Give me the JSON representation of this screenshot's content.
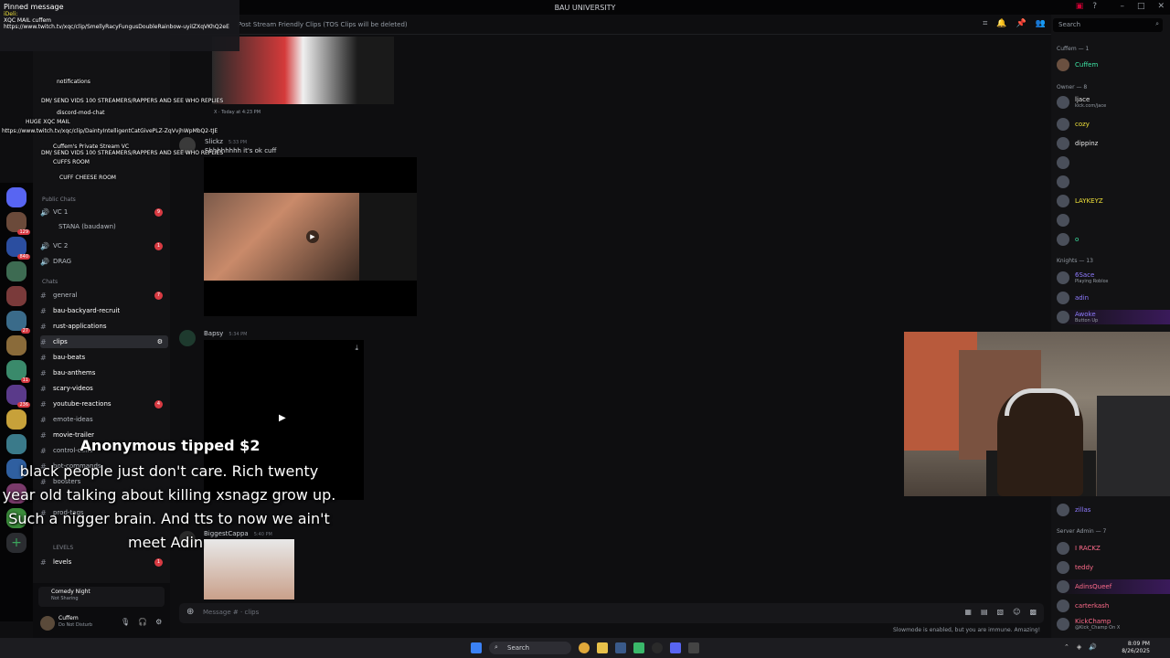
{
  "window": {
    "title": "BAU UNIVERSITY",
    "search_placeholder": "Search"
  },
  "pinned": {
    "header": "Pinned message",
    "author": "iDeli:",
    "lines": [
      "XQC MAIL cuffem",
      "https://www.twitch.tv/xqc/clip/SmellyRacyFungusDoubleRainbow-uyiIZXqVKhQ2eE"
    ]
  },
  "chat_overlay": [
    "notifications",
    "discord-mod-chat",
    "HUGE XQC MAIL",
    "https://www.twitch.tv/xqc/clip/DaintyIntelligentCatGivePLZ-ZqVvjhWpMbQ2-tJE",
    "DM/ SEND VIDS 100 STREAMERS/RAPPERS AND SEE WHO REPLIES",
    "Cuffem's Private Stream VC",
    "CUFFS ROOM",
    "CUFF CHEESE ROOM"
  ],
  "sidebar": {
    "categories": [
      "Public Chats",
      "Chats"
    ],
    "voice": [
      "VC 1",
      "VC 2",
      "DRAG"
    ],
    "voice_user": "STANA (baudawn)",
    "channels": [
      {
        "name": "general",
        "count": "7"
      },
      {
        "name": "bau-backyard-recruit",
        "count": ""
      },
      {
        "name": "rust-applications",
        "count": ""
      },
      {
        "name": "clips",
        "count": ""
      },
      {
        "name": "bau-beats",
        "count": ""
      },
      {
        "name": "bau-anthems",
        "count": ""
      },
      {
        "name": "scary-videos",
        "count": ""
      },
      {
        "name": "youtube-reactions",
        "count": "4"
      },
      {
        "name": "emote-ideas",
        "count": ""
      },
      {
        "name": "movie-trailer",
        "count": ""
      },
      {
        "name": "control-cuffs",
        "count": ""
      },
      {
        "name": "bot-commands",
        "count": ""
      },
      {
        "name": "boosters",
        "count": ""
      },
      {
        "name": "prod-tags",
        "count": ""
      },
      {
        "name": "levels",
        "count": "1"
      }
    ],
    "levels_category": "LEVELS",
    "stream_status": {
      "title": "Comedy Night",
      "sub": "Not Sharing"
    },
    "user": {
      "name": "Cuffem",
      "status": "Do Not Disturb"
    }
  },
  "main": {
    "header_text": "Post Stream Friendly Clips (TOS Clips will be deleted)",
    "reply_meta": "X · Today at 4:23 PM",
    "messages": [
      {
        "author": "Slickz",
        "time": "5:33 PM",
        "text": "Shhhhhhhh it's ok cuff"
      },
      {
        "author": "Bapsy",
        "time": "5:34 PM",
        "text": ""
      },
      {
        "author": "BiggestCappa",
        "time": "5:40 PM",
        "text": ""
      }
    ],
    "composer_placeholder": "Message # · clips",
    "slowmode": "Slowmode is enabled, but you are immune. Amazing!"
  },
  "members": {
    "groups": [
      {
        "title": "Cuffem — 1",
        "items": [
          {
            "name": "Cuffem",
            "color": "#3ee6a6",
            "sub": ""
          }
        ]
      },
      {
        "title": "Owner — 8",
        "items": [
          {
            "name": "ljace",
            "color": "#e6e6e6",
            "sub": "kick.com/jace"
          },
          {
            "name": "cozy",
            "color": "#f0e23a",
            "sub": ""
          },
          {
            "name": "dippinz",
            "color": "#e6e6e6",
            "sub": ""
          },
          {
            "name": "LAYKEYZ",
            "color": "#f0e23a",
            "sub": ""
          },
          {
            "name": "o",
            "color": "#3ee6a6",
            "sub": ""
          }
        ]
      },
      {
        "title": "Knights — 13",
        "items": [
          {
            "name": "6Sace",
            "color": "#8f7bff",
            "sub": "Playing Roblox"
          },
          {
            "name": "adin",
            "color": "#8f7bff",
            "sub": ""
          },
          {
            "name": "Awoke",
            "color": "#8f7bff",
            "sub": "Button Up"
          }
        ]
      },
      {
        "title": "Server Admin — 7",
        "items": [
          {
            "name": "I RACKZ",
            "color": "#ff6b8b",
            "sub": ""
          },
          {
            "name": "teddy",
            "color": "#ff6b8b",
            "sub": ""
          },
          {
            "name": "AdinsQueef",
            "color": "#ff6b8b",
            "sub": ""
          },
          {
            "name": "carterkash",
            "color": "#ff6b8b",
            "sub": ""
          },
          {
            "name": "KickChamp",
            "color": "#ff6b8b",
            "sub": "@Kick_Champ On X"
          }
        ]
      }
    ],
    "zillas": "zillas"
  },
  "tip": {
    "title": "Anonymous tipped $2",
    "lines": [
      "black people just don't care. Rich twenty",
      "year old talking about killing xsnagz grow up.",
      "Such a nigger brain. And tts to now we ain't",
      "meet Adin"
    ]
  },
  "taskbar": {
    "search": "Search",
    "time": "8:09 PM",
    "date": "8/26/2025"
  }
}
